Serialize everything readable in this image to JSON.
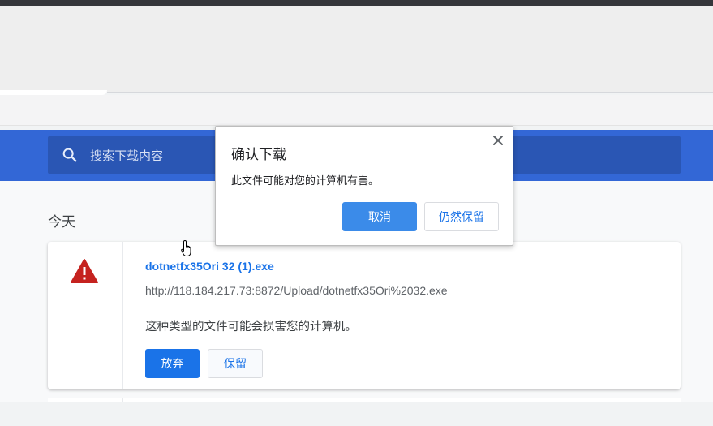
{
  "search": {
    "placeholder": "搜索下载内容"
  },
  "downloads": {
    "date_heading": "今天",
    "items": [
      {
        "file_name": "dotnetfx35Ori 32 (1).exe",
        "url": "http://118.184.217.73:8872/Upload/dotnetfx35Ori%2032.exe",
        "warning": "这种类型的文件可能会损害您的计算机。",
        "discard_label": "放弃",
        "keep_label": "保留",
        "status_icon": "warning-icon"
      }
    ]
  },
  "dialog": {
    "title": "确认下载",
    "message": "此文件可能对您的计算机有害。",
    "cancel_label": "取消",
    "keep_label": "仍然保留",
    "close_icon": "close-icon"
  },
  "colors": {
    "header": "#3367d6",
    "search_box": "#2a56b4",
    "accent": "#1a73e8",
    "warning": "#c5221f"
  }
}
